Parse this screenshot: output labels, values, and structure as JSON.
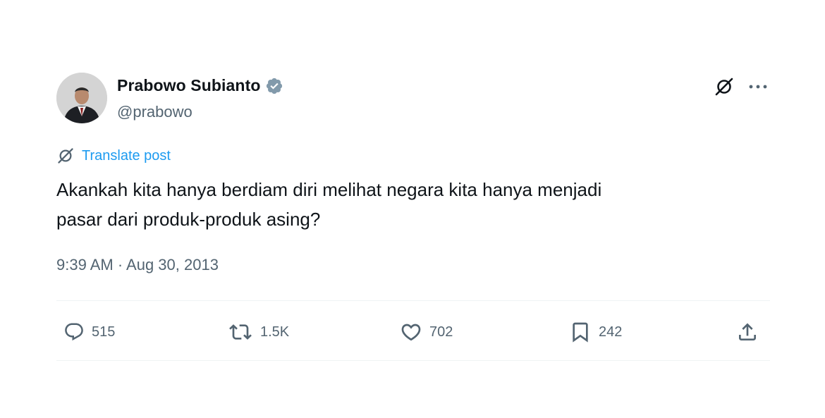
{
  "user": {
    "display_name": "Prabowo Subianto",
    "handle": "@prabowo",
    "verified_color": "#829aab"
  },
  "translate": {
    "label": "Translate post"
  },
  "post": {
    "text": "Akankah kita hanya berdiam diri melihat negara kita hanya menjadi\npasar dari produk-produk asing?",
    "timestamp": "9:39 AM · Aug 30, 2013"
  },
  "actions": {
    "replies": "515",
    "reposts": "1.5K",
    "likes": "702",
    "bookmarks": "242"
  },
  "icons": [
    "grok-icon",
    "more-icon",
    "reply-icon",
    "repost-icon",
    "like-icon",
    "bookmark-icon",
    "share-icon"
  ],
  "colors": {
    "text_primary": "#0f1419",
    "text_secondary": "#536471",
    "link": "#1d9bf0",
    "divider": "#eff3f4"
  }
}
